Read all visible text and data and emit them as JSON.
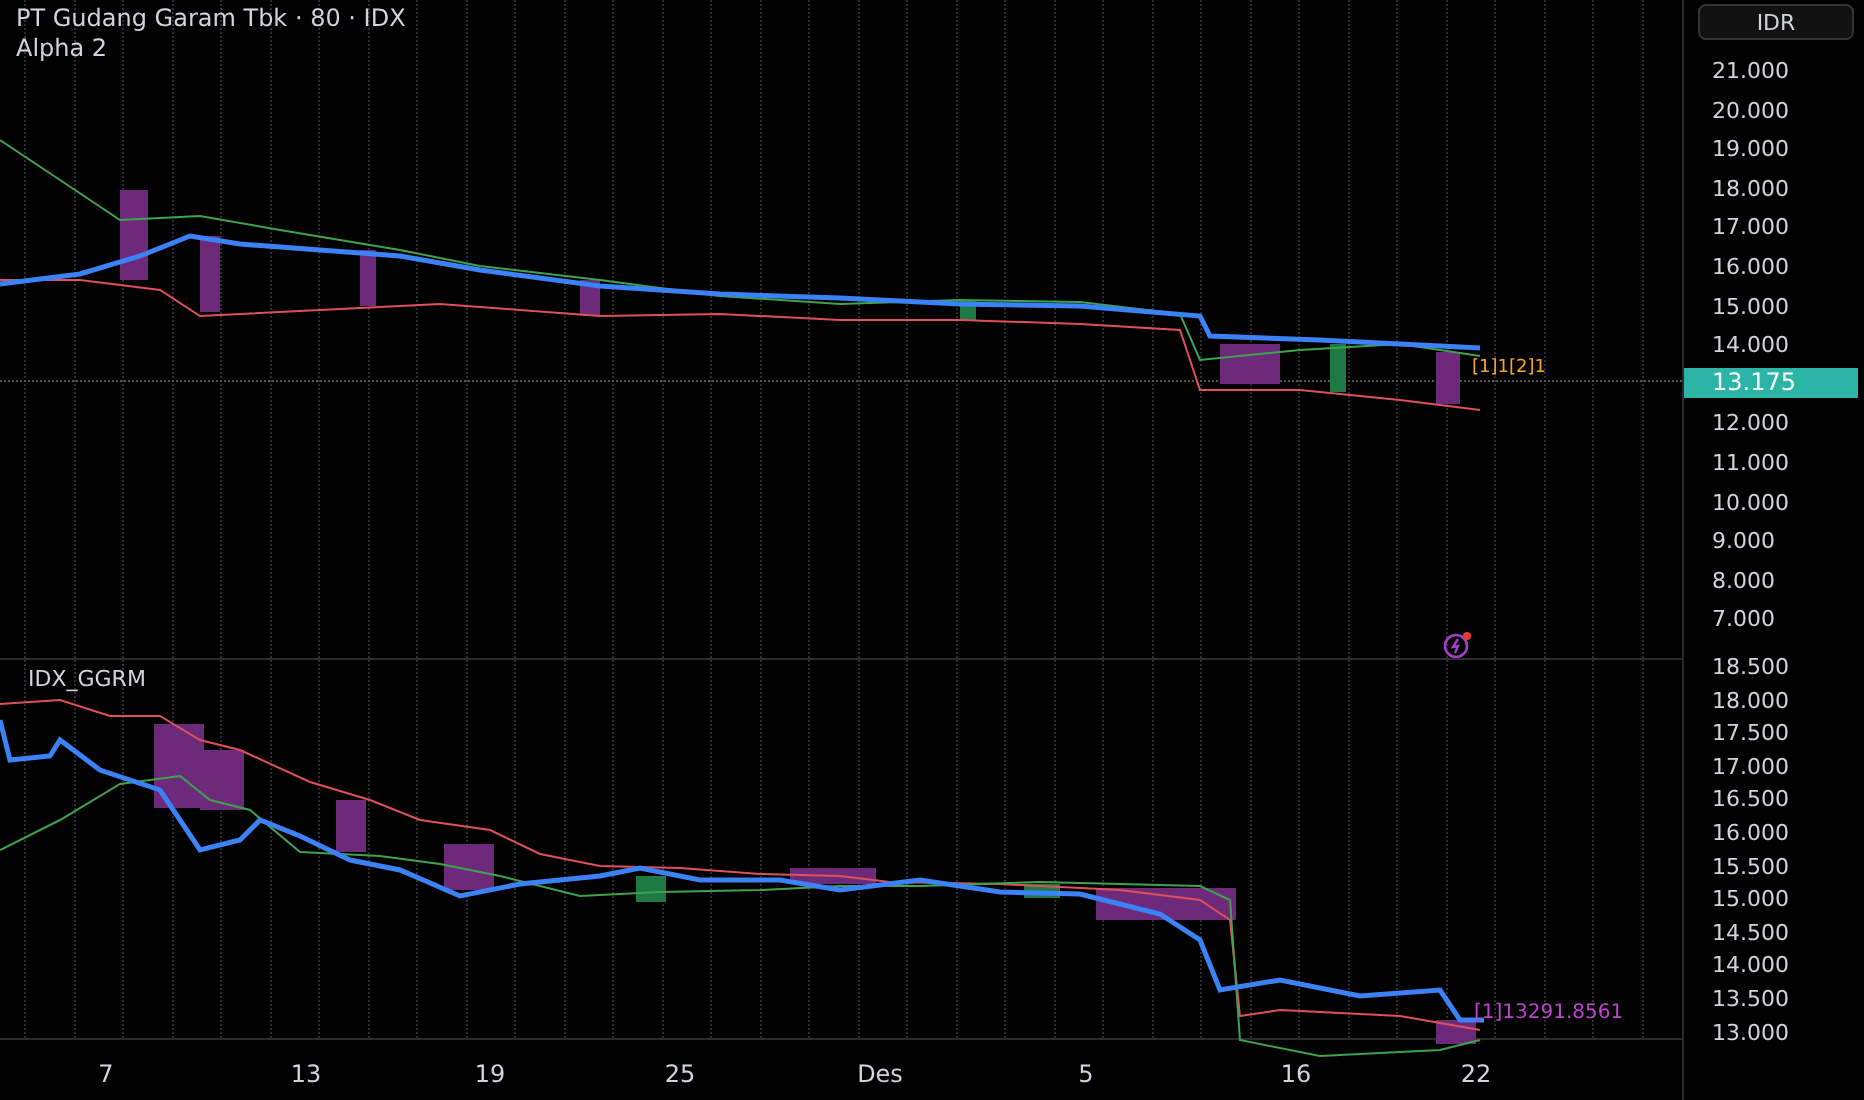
{
  "header": {
    "title": "PT Gudang Garam Tbk · 80 · IDX",
    "indicator": "Alpha 2"
  },
  "currency_button": "IDR",
  "price_axis": [
    "21.000",
    "20.000",
    "19.000",
    "18.000",
    "17.000",
    "16.000",
    "15.000",
    "14.000",
    "12.000",
    "11.000",
    "10.000",
    "9.000",
    "8.000",
    "7.000"
  ],
  "last_price": "13.175",
  "overlay_label": "[1]1[2]1",
  "lower_pane": {
    "title": "IDX_GGRM",
    "axis": [
      "18.500",
      "18.000",
      "17.500",
      "17.000",
      "16.500",
      "16.000",
      "15.500",
      "15.000",
      "14.500",
      "14.000",
      "13.500",
      "13.000"
    ],
    "value_label": "[1]13291.8561"
  },
  "time_axis": [
    "7",
    "13",
    "19",
    "25",
    "Des",
    "5",
    "16",
    "22"
  ]
}
